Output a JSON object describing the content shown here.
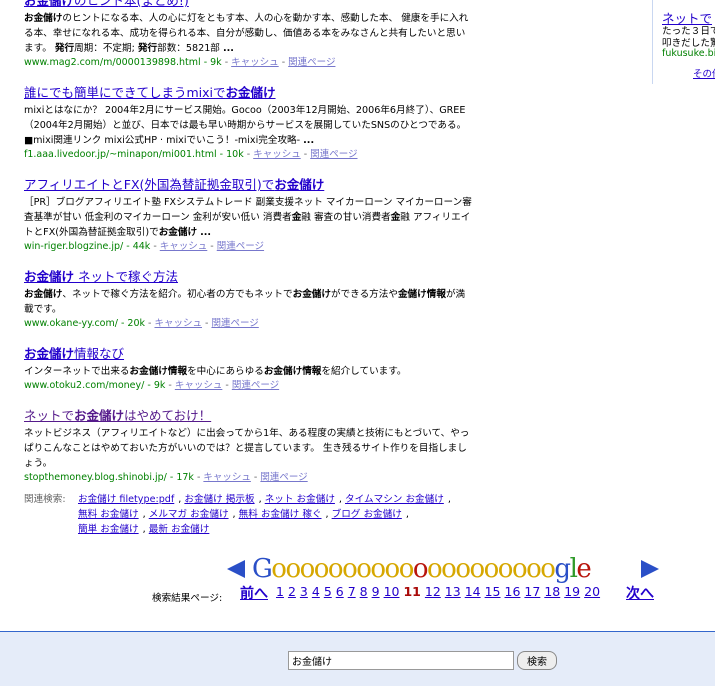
{
  "results": [
    {
      "title_html": "<b>お金儲け</b>のヒント本(まとめ!)",
      "snippet_html": "<b>お金儲け</b>のヒントになる本、人の心に灯をともす本、人の心を動かす本、感動した本、 健康を手に入れる本、幸せになれる本、成功を得られる本、自分が感動し、価値ある本をみなさんと共有したいと思います。 <b>発行</b>周期：不定期; <b>発行</b>部数：5821部 <b>...</b>",
      "url": "www.mag2.com/m/0000139898.html - 9k",
      "cache": "キャッシュ",
      "related": "関連ページ",
      "visited": false
    },
    {
      "title_html": "誰にでも簡単にできてしまうmixiで<b>お金儲け</b>",
      "snippet_html": "mixiとはなにか？ 2004年2月にサービス開始。Gocoo（2003年12月開始、2006年6月終了）、GREE（2004年2月開始）と並び、日本では最も早い時期からサービスを展開していたSNSのひとつである。 ■mixi関連リンク mixi公式HP · mixiでいこう！-mixi完全攻略- <b>...</b>",
      "url": "f1.aaa.livedoor.jp/~minapon/mi001.html - 10k",
      "cache": "キャッシュ",
      "related": "関連ページ",
      "visited": false
    },
    {
      "title_html": "アフィリエイトとFX(外国為替証拠金取引)で<b>お金儲け</b>",
      "snippet_html": "［PR］ブログアフィリエイト塾 FXシステムトレード 副業支援ネット マイカーローン マイカーローン審査基準が甘い 低金利のマイカーローン 金利が安い低い 消費者<b>金</b>融 審査の甘い消費者<b>金</b>融 アフィリエイトとFX(外国為替証拠金取引)で<b>お金儲け</b> <b>...</b>",
      "url": "win-riger.blogzine.jp/ - 44k",
      "cache": "キャッシュ",
      "related": "関連ページ",
      "visited": false
    },
    {
      "title_html": "<b>お金儲け</b> ネットで稼ぐ方法",
      "snippet_html": "<b>お金儲け</b>、ネットで稼ぐ方法を紹介。初心者の方でもネットで<b>お金儲け</b>ができる方法や<b>金儲け情報</b>が満載です。",
      "url": "www.okane-yy.com/ - 20k",
      "cache": "キャッシュ",
      "related": "関連ページ",
      "visited": false
    },
    {
      "title_html": "<b>お金儲け</b>情報なび",
      "snippet_html": "インターネットで出来る<b>お金儲け情報</b>を中心にあらゆる<b>お金儲け情報</b>を紹介しています。",
      "url": "www.otoku2.com/money/ - 9k",
      "cache": "キャッシュ",
      "related": "関連ページ",
      "visited": false
    },
    {
      "title_html": "ネットで<b>お金儲け</b>はやめておけ！",
      "snippet_html": "ネットビジネス（アフィリエイトなど）に出会ってから1年、ある程度の実績と技術にもとづいて、やっぱりこんなことはやめておいた方がいいのでは？と提言しています。 生き残るサイト作りを目指しましょう。",
      "url": "stopthemoney.blog.shinobi.jp/ - 17k",
      "cache": "キャッシュ",
      "related": "関連ページ",
      "visited": true
    }
  ],
  "related_searches": {
    "label": "関連検索:",
    "rows": [
      [
        "お金儲け filetype:pdf",
        "お金儲け 掲示板",
        "ネット お金儲け",
        "タイムマシン お金儲け"
      ],
      [
        "無料 お金儲け",
        "メルマガ お金儲け",
        "無料 お金儲け 稼ぐ",
        "ブログ お金儲け"
      ],
      [
        "簡単 お金儲け",
        "最新 お金儲け"
      ]
    ]
  },
  "sidebar_ad": {
    "title": "ネットで",
    "text_line1": "たった３日で",
    "text_line2": "叩きだした驚",
    "url": "fukusuke.bi",
    "more": "その他"
  },
  "pagination": {
    "label": "検索結果ページ:",
    "prev": "前へ",
    "next": "次へ",
    "pages": [
      "1",
      "2",
      "3",
      "4",
      "5",
      "6",
      "7",
      "8",
      "9",
      "10",
      "11",
      "12",
      "13",
      "14",
      "15",
      "16",
      "17",
      "18",
      "19",
      "20"
    ],
    "current": "11",
    "logo_letters": [
      "G",
      "o",
      "o",
      "o",
      "o",
      "o",
      "o",
      "o",
      "o",
      "o",
      "o",
      "o",
      "o",
      "o",
      "o",
      "o",
      "o",
      "o",
      "o",
      "o",
      "o",
      "g",
      "l",
      "e"
    ],
    "colors": {
      "blue": "#2a4fc7",
      "yellow": "#d6a700",
      "red": "#b8150c",
      "green": "#2f9a2a"
    }
  },
  "search": {
    "value": "お金儲け",
    "button_label": "検索"
  }
}
